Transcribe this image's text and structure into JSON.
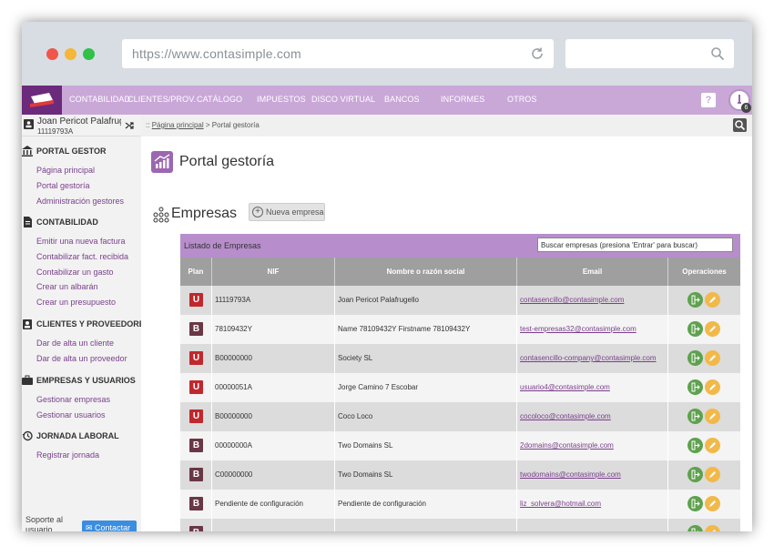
{
  "browser": {
    "url": "https://www.contasimple.com"
  },
  "nav": {
    "items": [
      "CONTABILIDAD",
      "CLIENTES/PROV.",
      "CATÁLOGO",
      "IMPUESTOS",
      "DISCO VIRTUAL",
      "BANCOS",
      "INFORMES",
      "OTROS"
    ],
    "help": "?",
    "notifications": "6"
  },
  "user": {
    "name": "Joan Pericot Palafrugell",
    "nif": "11119793A"
  },
  "sidebar": {
    "sections": [
      {
        "title": "PORTAL GESTOR",
        "links": [
          "Página principal",
          "Portal gestoría",
          "Administración gestores"
        ]
      },
      {
        "title": "CONTABILIDAD",
        "links": [
          "Emitir una nueva factura",
          "Contabilizar fact. recibida",
          "Contabilizar un gasto",
          "Crear un albarán",
          "Crear un presupuesto"
        ]
      },
      {
        "title": "CLIENTES Y PROVEEDORES",
        "links": [
          "Dar de alta un cliente",
          "Dar de alta un proveedor"
        ]
      },
      {
        "title": "EMPRESAS Y USUARIOS",
        "links": [
          "Gestionar empresas",
          "Gestionar usuarios"
        ]
      },
      {
        "title": "JORNADA LABORAL",
        "links": [
          "Registrar jornada"
        ]
      }
    ],
    "support": "Soporte al usuario",
    "contact": "Contactar"
  },
  "breadcrumb": {
    "prefix": "::",
    "home": "Página principal",
    "separator": ">",
    "current": "Portal gestoría"
  },
  "page": {
    "title": "Portal gestoría",
    "section_title": "Empresas",
    "new_button": "Nueva empresa"
  },
  "table": {
    "title": "Listado de Empresas",
    "search_placeholder": "Buscar empresas (presiona 'Entrar' para buscar)",
    "headers": [
      "Plan",
      "NIF",
      "Nombre o razón social",
      "Email",
      "Operaciones"
    ],
    "rows": [
      {
        "plan": "U",
        "nif": "11119793A",
        "name": "Joan Pericot Palafrugello",
        "email": "contasencillo@contasimple.com"
      },
      {
        "plan": "B",
        "nif": "78109432Y",
        "name": "Name 78109432Y Firstname 78109432Y",
        "email": "test-empresas32@contasimple.com"
      },
      {
        "plan": "U",
        "nif": "B00000000",
        "name": "Society SL",
        "email": "contasencillo-company@contasimple.com"
      },
      {
        "plan": "U",
        "nif": "00000051A",
        "name": "Jorge Camino 7 Escobar",
        "email": "usuario4@contasimple.com"
      },
      {
        "plan": "U",
        "nif": "B00000000",
        "name": "Coco Loco",
        "email": "cocoloco@contasimple.com"
      },
      {
        "plan": "B",
        "nif": "00000000A",
        "name": "Two Domains SL",
        "email": "2domains@contasimple.com"
      },
      {
        "plan": "B",
        "nif": "C00000000",
        "name": "Two Domains SL",
        "email": "twodomains@contasimple.com"
      },
      {
        "plan": "B",
        "nif": "Pendiente de configuración",
        "name": "Pendiente de configuración",
        "email": "liz_solvera@hotmail.com"
      },
      {
        "plan": "B",
        "nif": "",
        "name": "",
        "email": ""
      }
    ]
  },
  "colors": {
    "plan_U": "#c0282d",
    "plan_B": "#6a3746"
  }
}
